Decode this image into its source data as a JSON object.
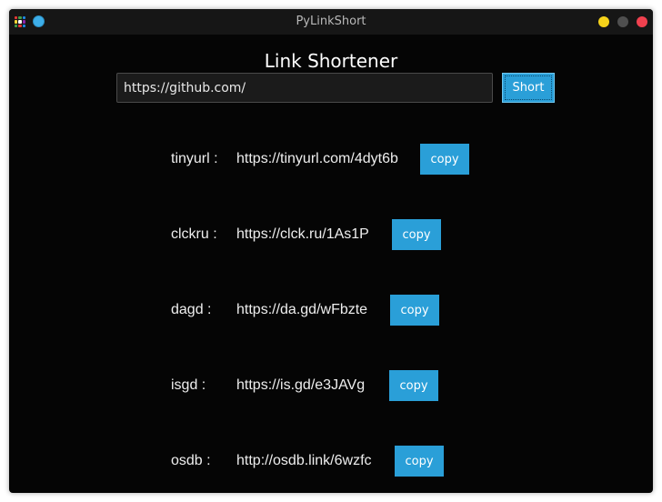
{
  "window": {
    "title": "PyLinkShort",
    "controls": [
      "minimize-icon",
      "maximize-icon",
      "close-icon"
    ]
  },
  "heading": "Link Shortener",
  "input": {
    "value": "https://github.com/",
    "placeholder": ""
  },
  "short_label": "Short",
  "results": [
    {
      "service": "tinyurl :",
      "url": "https://tinyurl.com/4dyt6b",
      "copy_label": "copy"
    },
    {
      "service": "clckru :",
      "url": "https://clck.ru/1As1P",
      "copy_label": "copy"
    },
    {
      "service": "dagd :",
      "url": "https://da.gd/wFbzte",
      "copy_label": "copy"
    },
    {
      "service": "isgd :",
      "url": "https://is.gd/e3JAVg",
      "copy_label": "copy"
    },
    {
      "service": "osdb :",
      "url": "http://osdb.link/6wzfc",
      "copy_label": "copy"
    }
  ],
  "colors": {
    "accent": "#2a9fd8",
    "background": "#050505",
    "minimize": "#f5d21a",
    "maximize": "#4f4f4f",
    "close": "#f0414f"
  }
}
